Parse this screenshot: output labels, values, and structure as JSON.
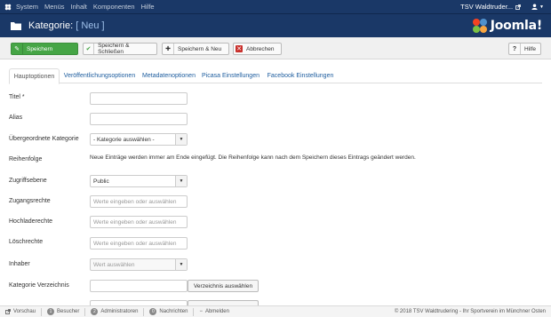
{
  "topnav": {
    "menu": [
      "System",
      "Menüs",
      "Inhalt",
      "Komponenten",
      "Hilfe"
    ],
    "site_name": "TSV Waldtruder...",
    "site_icon": "external-link-icon",
    "user_icon": "user-icon"
  },
  "header": {
    "title_prefix": "Kategorie: ",
    "title_suffix": "[ Neu ]",
    "brand": "Joomla!"
  },
  "toolbar": {
    "save": "Speichern",
    "save_close": "Speichern & Schließen",
    "save_new": "Speichern & Neu",
    "cancel": "Abbrechen",
    "help": "Hilfe"
  },
  "tabs": [
    "Hauptoptionen",
    "Veröffentlichungsoptionen",
    "Metadatenoptionen",
    "Picasa Einstellungen",
    "Facebook Einstellungen"
  ],
  "form": {
    "title_label": "Titel *",
    "alias_label": "Alias",
    "parent_label": "Übergeordnete Kategorie",
    "parent_value": "- Kategorie auswählen -",
    "order_label": "Reihenfolge",
    "order_notice": "Neue Einträge werden immer am Ende eingefügt. Die Reihenfolge kann nach dem Speichern dieses Eintrags geändert werden.",
    "access_label": "Zugriffsebene",
    "access_value": "Public",
    "access_rights_label": "Zugangsrechte",
    "upload_rights_label": "Hochladerechte",
    "delete_rights_label": "Löschrechte",
    "owner_label": "Inhaber",
    "owner_placeholder": "Wert auswählen",
    "rights_placeholder": "Werte eingeben oder auswählen",
    "dir_label": "Kategorie Verzeichnis",
    "dir_button": "Verzeichnis auswählen"
  },
  "statusbar": {
    "preview": "Vorschau",
    "visitors_count": "1",
    "visitors": "Besucher",
    "admins_count": "2",
    "admins": "Administratoren",
    "messages_count": "0",
    "messages": "Nachrichten",
    "logout": "Abmelden",
    "copyright": "© 2018 TSV Waldtrudering - Ihr Sportverein im Münchner Osten"
  },
  "colors": {
    "nav_bg": "#1a3867",
    "green": "#46a546",
    "link": "#1c5c9e"
  }
}
